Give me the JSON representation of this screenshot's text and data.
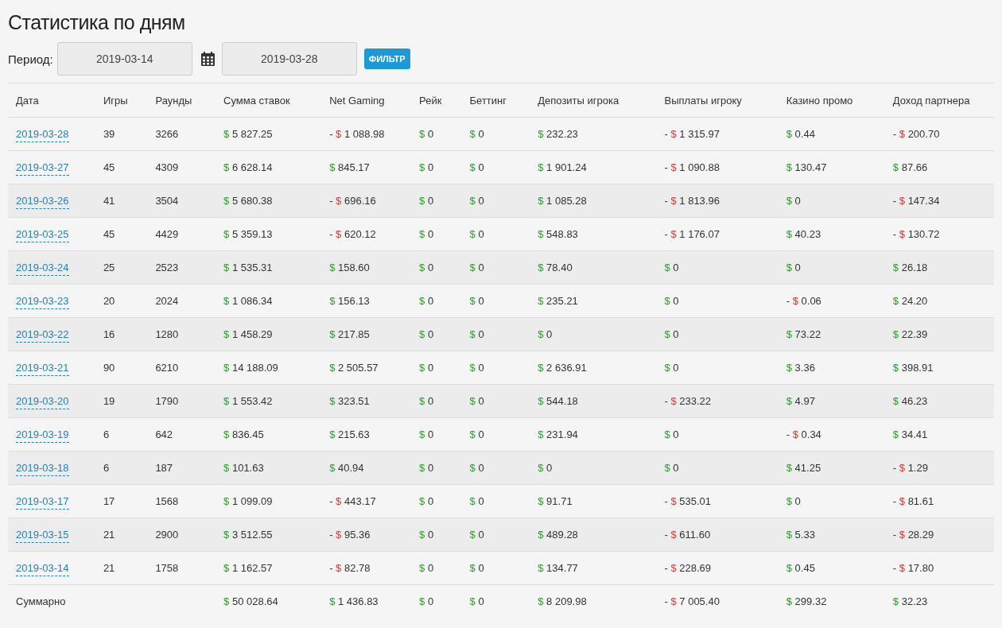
{
  "title": "Статистика по дням",
  "filter": {
    "label": "Период:",
    "date_from": "2019-03-14",
    "date_to": "2019-03-28",
    "button": "ФИЛЬТР"
  },
  "columns": [
    "Дата",
    "Игры",
    "Раунды",
    "Сумма ставок",
    "Net Gaming",
    "Рейк",
    "Беттинг",
    "Депозиты игрока",
    "Выплаты игроку",
    "Казино промо",
    "Доход партнера"
  ],
  "rows": [
    {
      "date": "2019-03-28",
      "games": "39",
      "rounds": "3266",
      "money": [
        {
          "currency": "$",
          "amount": "5 827.25"
        },
        {
          "sign": "-",
          "currency": "$",
          "amount": "1 088.98"
        },
        {
          "currency": "$",
          "amount": "0"
        },
        {
          "currency": "$",
          "amount": "0"
        },
        {
          "currency": "$",
          "amount": "232.23"
        },
        {
          "sign": "-",
          "currency": "$",
          "amount": "1 315.97"
        },
        {
          "currency": "$",
          "amount": "0.44"
        },
        {
          "sign": "-",
          "currency": "$",
          "amount": "200.70"
        }
      ]
    },
    {
      "date": "2019-03-27",
      "games": "45",
      "rounds": "4309",
      "money": [
        {
          "currency": "$",
          "amount": "6 628.14"
        },
        {
          "currency": "$",
          "amount": "845.17"
        },
        {
          "currency": "$",
          "amount": "0"
        },
        {
          "currency": "$",
          "amount": "0"
        },
        {
          "currency": "$",
          "amount": "1 901.24"
        },
        {
          "sign": "-",
          "currency": "$",
          "amount": "1 090.88"
        },
        {
          "currency": "$",
          "amount": "130.47"
        },
        {
          "currency": "$",
          "amount": "87.66"
        }
      ]
    },
    {
      "date": "2019-03-26",
      "games": "41",
      "rounds": "3504",
      "money": [
        {
          "currency": "$",
          "amount": "5 680.38"
        },
        {
          "sign": "-",
          "currency": "$",
          "amount": "696.16"
        },
        {
          "currency": "$",
          "amount": "0"
        },
        {
          "currency": "$",
          "amount": "0"
        },
        {
          "currency": "$",
          "amount": "1 085.28"
        },
        {
          "sign": "-",
          "currency": "$",
          "amount": "1 813.96"
        },
        {
          "currency": "$",
          "amount": "0"
        },
        {
          "sign": "-",
          "currency": "$",
          "amount": "147.34"
        }
      ]
    },
    {
      "date": "2019-03-25",
      "games": "45",
      "rounds": "4429",
      "money": [
        {
          "currency": "$",
          "amount": "5 359.13"
        },
        {
          "sign": "-",
          "currency": "$",
          "amount": "620.12"
        },
        {
          "currency": "$",
          "amount": "0"
        },
        {
          "currency": "$",
          "amount": "0"
        },
        {
          "currency": "$",
          "amount": "548.83"
        },
        {
          "sign": "-",
          "currency": "$",
          "amount": "1 176.07"
        },
        {
          "currency": "$",
          "amount": "40.23"
        },
        {
          "sign": "-",
          "currency": "$",
          "amount": "130.72"
        }
      ]
    },
    {
      "date": "2019-03-24",
      "games": "25",
      "rounds": "2523",
      "money": [
        {
          "currency": "$",
          "amount": "1 535.31"
        },
        {
          "currency": "$",
          "amount": "158.60"
        },
        {
          "currency": "$",
          "amount": "0"
        },
        {
          "currency": "$",
          "amount": "0"
        },
        {
          "currency": "$",
          "amount": "78.40"
        },
        {
          "currency": "$",
          "amount": "0"
        },
        {
          "currency": "$",
          "amount": "0"
        },
        {
          "currency": "$",
          "amount": "26.18"
        }
      ]
    },
    {
      "date": "2019-03-23",
      "games": "20",
      "rounds": "2024",
      "money": [
        {
          "currency": "$",
          "amount": "1 086.34"
        },
        {
          "currency": "$",
          "amount": "156.13"
        },
        {
          "currency": "$",
          "amount": "0"
        },
        {
          "currency": "$",
          "amount": "0"
        },
        {
          "currency": "$",
          "amount": "235.21"
        },
        {
          "currency": "$",
          "amount": "0"
        },
        {
          "sign": "-",
          "currency": "$",
          "amount": "0.06"
        },
        {
          "currency": "$",
          "amount": "24.20"
        }
      ]
    },
    {
      "date": "2019-03-22",
      "games": "16",
      "rounds": "1280",
      "money": [
        {
          "currency": "$",
          "amount": "1 458.29"
        },
        {
          "currency": "$",
          "amount": "217.85"
        },
        {
          "currency": "$",
          "amount": "0"
        },
        {
          "currency": "$",
          "amount": "0"
        },
        {
          "currency": "$",
          "amount": "0"
        },
        {
          "currency": "$",
          "amount": "0"
        },
        {
          "currency": "$",
          "amount": "73.22"
        },
        {
          "currency": "$",
          "amount": "22.39"
        }
      ]
    },
    {
      "date": "2019-03-21",
      "games": "90",
      "rounds": "6210",
      "money": [
        {
          "currency": "$",
          "amount": "14 188.09"
        },
        {
          "currency": "$",
          "amount": "2 505.57"
        },
        {
          "currency": "$",
          "amount": "0"
        },
        {
          "currency": "$",
          "amount": "0"
        },
        {
          "currency": "$",
          "amount": "2 636.91"
        },
        {
          "currency": "$",
          "amount": "0"
        },
        {
          "currency": "$",
          "amount": "3.36"
        },
        {
          "currency": "$",
          "amount": "398.91"
        }
      ]
    },
    {
      "date": "2019-03-20",
      "games": "19",
      "rounds": "1790",
      "money": [
        {
          "currency": "$",
          "amount": "1 553.42"
        },
        {
          "currency": "$",
          "amount": "323.51"
        },
        {
          "currency": "$",
          "amount": "0"
        },
        {
          "currency": "$",
          "amount": "0"
        },
        {
          "currency": "$",
          "amount": "544.18"
        },
        {
          "sign": "-",
          "currency": "$",
          "amount": "233.22"
        },
        {
          "currency": "$",
          "amount": "4.97"
        },
        {
          "currency": "$",
          "amount": "46.23"
        }
      ]
    },
    {
      "date": "2019-03-19",
      "games": "6",
      "rounds": "642",
      "money": [
        {
          "currency": "$",
          "amount": "836.45"
        },
        {
          "currency": "$",
          "amount": "215.63"
        },
        {
          "currency": "$",
          "amount": "0"
        },
        {
          "currency": "$",
          "amount": "0"
        },
        {
          "currency": "$",
          "amount": "231.94"
        },
        {
          "currency": "$",
          "amount": "0"
        },
        {
          "sign": "-",
          "currency": "$",
          "amount": "0.34"
        },
        {
          "currency": "$",
          "amount": "34.41"
        }
      ]
    },
    {
      "date": "2019-03-18",
      "games": "6",
      "rounds": "187",
      "money": [
        {
          "currency": "$",
          "amount": "101.63"
        },
        {
          "currency": "$",
          "amount": "40.94"
        },
        {
          "currency": "$",
          "amount": "0"
        },
        {
          "currency": "$",
          "amount": "0"
        },
        {
          "currency": "$",
          "amount": "0"
        },
        {
          "currency": "$",
          "amount": "0"
        },
        {
          "currency": "$",
          "amount": "41.25"
        },
        {
          "sign": "-",
          "currency": "$",
          "amount": "1.29"
        }
      ]
    },
    {
      "date": "2019-03-17",
      "games": "17",
      "rounds": "1568",
      "money": [
        {
          "currency": "$",
          "amount": "1 099.09"
        },
        {
          "sign": "-",
          "currency": "$",
          "amount": "443.17"
        },
        {
          "currency": "$",
          "amount": "0"
        },
        {
          "currency": "$",
          "amount": "0"
        },
        {
          "currency": "$",
          "amount": "91.71"
        },
        {
          "sign": "-",
          "currency": "$",
          "amount": "535.01"
        },
        {
          "currency": "$",
          "amount": "0"
        },
        {
          "sign": "-",
          "currency": "$",
          "amount": "81.61"
        }
      ]
    },
    {
      "date": "2019-03-15",
      "games": "21",
      "rounds": "2900",
      "money": [
        {
          "currency": "$",
          "amount": "3 512.55"
        },
        {
          "sign": "-",
          "currency": "$",
          "amount": "95.36"
        },
        {
          "currency": "$",
          "amount": "0"
        },
        {
          "currency": "$",
          "amount": "0"
        },
        {
          "currency": "$",
          "amount": "489.28"
        },
        {
          "sign": "-",
          "currency": "$",
          "amount": "611.60"
        },
        {
          "currency": "$",
          "amount": "5.33"
        },
        {
          "sign": "-",
          "currency": "$",
          "amount": "28.29"
        }
      ]
    },
    {
      "date": "2019-03-14",
      "games": "21",
      "rounds": "1758",
      "money": [
        {
          "currency": "$",
          "amount": "1 162.57"
        },
        {
          "sign": "-",
          "currency": "$",
          "amount": "82.78"
        },
        {
          "currency": "$",
          "amount": "0"
        },
        {
          "currency": "$",
          "amount": "0"
        },
        {
          "currency": "$",
          "amount": "134.77"
        },
        {
          "sign": "-",
          "currency": "$",
          "amount": "228.69"
        },
        {
          "currency": "$",
          "amount": "0.45"
        },
        {
          "sign": "-",
          "currency": "$",
          "amount": "17.80"
        }
      ]
    }
  ],
  "total": {
    "label": "Суммарно",
    "money": [
      {
        "currency": "$",
        "amount": "50 028.64"
      },
      {
        "currency": "$",
        "amount": "1 436.83"
      },
      {
        "currency": "$",
        "amount": "0"
      },
      {
        "currency": "$",
        "amount": "0"
      },
      {
        "currency": "$",
        "amount": "8 209.98"
      },
      {
        "sign": "-",
        "currency": "$",
        "amount": "7 005.40"
      },
      {
        "currency": "$",
        "amount": "299.32"
      },
      {
        "currency": "$",
        "amount": "32.23"
      }
    ]
  }
}
